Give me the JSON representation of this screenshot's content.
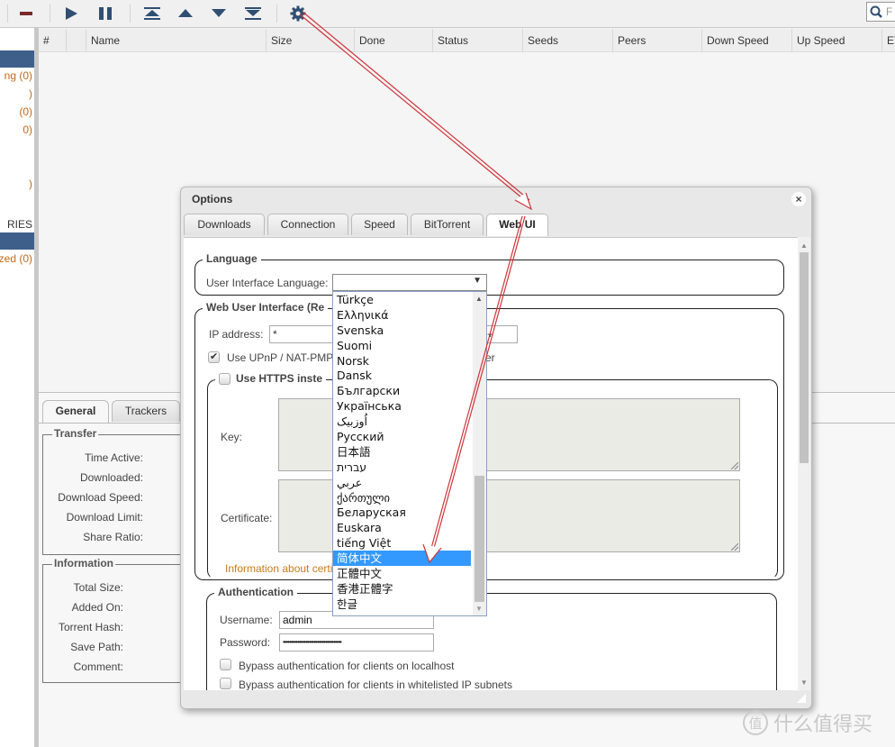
{
  "toolbar": {
    "buttons": [
      {
        "name": "remove",
        "icon": "minus-icon"
      },
      {
        "name": "resume",
        "icon": "play-icon"
      },
      {
        "name": "pause",
        "icon": "pause-icon"
      },
      {
        "name": "move-top",
        "icon": "top-icon"
      },
      {
        "name": "move-up",
        "icon": "up-icon"
      },
      {
        "name": "move-down",
        "icon": "down-icon"
      },
      {
        "name": "move-bottom",
        "icon": "bottom-icon"
      },
      {
        "name": "options",
        "icon": "gear-icon"
      }
    ],
    "search_placeholder": "F"
  },
  "sidebar": {
    "items": [
      "ng (0)",
      ")",
      " (0)",
      "0)",
      "",
      "",
      ")"
    ],
    "categories_heading": "RIES",
    "category_items": [
      "zed (0)"
    ]
  },
  "table": {
    "columns": [
      "#",
      "",
      "Name",
      "Size",
      "Done",
      "Status",
      "Seeds",
      "Peers",
      "Down Speed",
      "Up Speed",
      "ET"
    ]
  },
  "properties": {
    "tabs": [
      "General",
      "Trackers"
    ],
    "transfer": {
      "legend": "Transfer",
      "labels": [
        "Time Active:",
        "Downloaded:",
        "Download Speed:",
        "Download Limit:",
        "Share Ratio:"
      ]
    },
    "information": {
      "legend": "Information",
      "labels": [
        "Total Size:",
        "Added On:",
        "Torrent Hash:",
        "Save Path:",
        "Comment:"
      ]
    }
  },
  "dialog": {
    "title": "Options",
    "close": "×",
    "tabs": [
      "Downloads",
      "Connection",
      "Speed",
      "BitTorrent",
      "Web UI"
    ],
    "active_tab": "Web UI",
    "language": {
      "legend": "Language",
      "label": "User Interface Language:",
      "value": "",
      "options": [
        "Türkçe",
        "Ελληνικά",
        "Svenska",
        "Suomi",
        "Norsk",
        "Dansk",
        "Български",
        "Українська",
        "اُوزبیک",
        "Русский",
        "日本語",
        "עברית",
        "عربي",
        "ქართული",
        "Беларуская",
        "Euskara",
        "tiếng Việt",
        "简体中文",
        "正體中文",
        "香港正體字",
        "한글"
      ],
      "highlighted": "简体中文"
    },
    "webui": {
      "legend": "Web User Interface (Re",
      "ip_label": "IP address:",
      "ip_value": "*",
      "port_value": "+",
      "upnp_label": "Use UPnP / NAT-PMP",
      "upnp_suffix": "er",
      "upnp_checked": true,
      "https": {
        "legend": "Use HTTPS inste",
        "checked": false,
        "key_label": "Key:",
        "cert_label": "Certificate:",
        "info_link": "Information about certi"
      }
    },
    "auth": {
      "legend": "Authentication",
      "username_label": "Username:",
      "username_value": "admin",
      "password_label": "Password:",
      "password_value": "••••••••••••••••••••••••••••••••••••",
      "bypass_localhost": "Bypass authentication for clients on localhost",
      "bypass_whitelist": "Bypass authentication for clients in whitelisted IP subnets"
    }
  },
  "watermark": {
    "logo": "值",
    "text": "什么值得买"
  },
  "annotation_color": "#d0343a"
}
